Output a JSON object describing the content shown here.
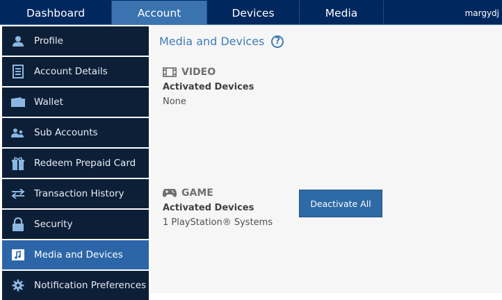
{
  "topnav": {
    "tabs": [
      {
        "label": "Dashboard"
      },
      {
        "label": "Account"
      },
      {
        "label": "Devices"
      },
      {
        "label": "Media"
      }
    ],
    "user": "margydj"
  },
  "sidebar": {
    "items": [
      {
        "label": "Profile",
        "icon": "user-icon"
      },
      {
        "label": "Account Details",
        "icon": "document-icon"
      },
      {
        "label": "Wallet",
        "icon": "wallet-icon"
      },
      {
        "label": "Sub Accounts",
        "icon": "sub-accounts-icon"
      },
      {
        "label": "Redeem Prepaid Card",
        "icon": "gift-icon"
      },
      {
        "label": "Transaction History",
        "icon": "transfer-arrows-icon"
      },
      {
        "label": "Security",
        "icon": "lock-icon"
      },
      {
        "label": "Media and Devices",
        "icon": "music-note-icon",
        "active": true
      },
      {
        "label": "Notification Preferences",
        "icon": "gear-icon"
      }
    ]
  },
  "main": {
    "title": "Media and Devices",
    "help_symbol": "?",
    "video": {
      "heading": "VIDEO",
      "icon": "film-icon",
      "activated_label": "Activated Devices",
      "value": "None"
    },
    "game": {
      "heading": "GAME",
      "icon": "gamepad-icon",
      "activated_label": "Activated Devices",
      "value": "1 PlayStation® Systems",
      "button_label": "Deactivate All"
    }
  },
  "colors": {
    "nav_bg": "#00285f",
    "active_tab": "#3a73b0",
    "sidebar_bg": "#0d1f37",
    "sidebar_active": "#2c66a8",
    "accent": "#3f7cb5",
    "button": "#2d6aa6"
  }
}
